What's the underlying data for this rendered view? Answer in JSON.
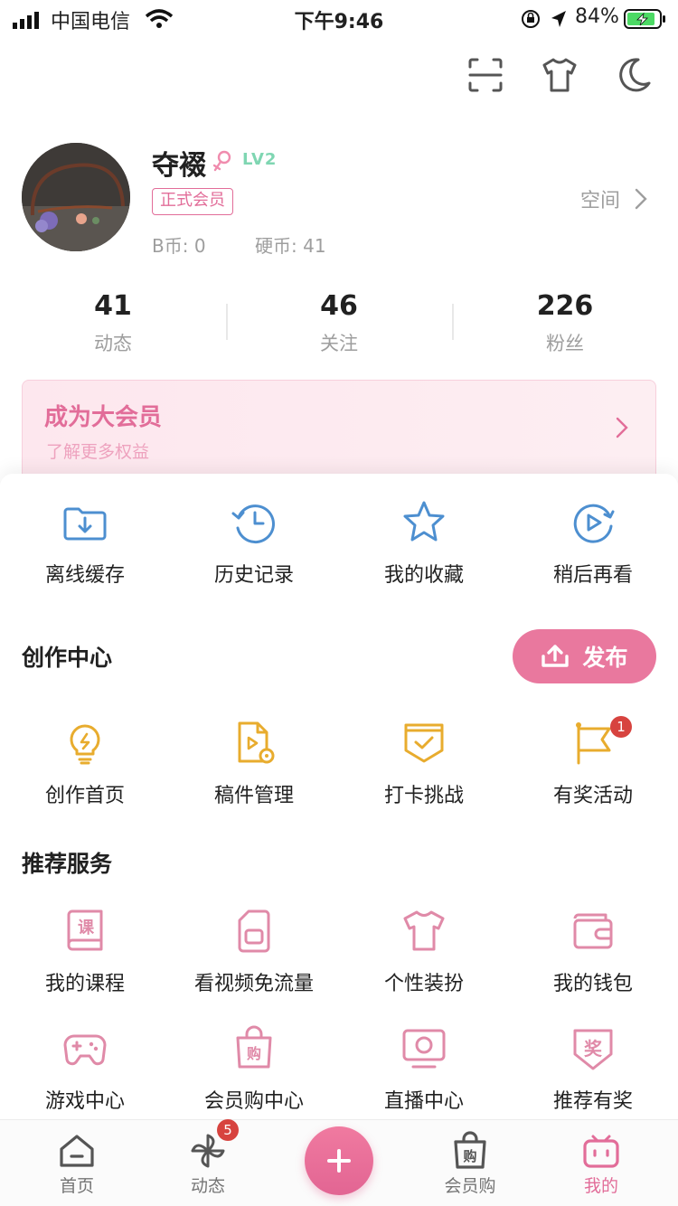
{
  "status_bar": {
    "carrier": "中国电信",
    "time": "下午9:46",
    "battery": "84%"
  },
  "header_icons": [
    "scan-icon",
    "tshirt-icon",
    "moon-icon"
  ],
  "profile": {
    "username": "夺裰",
    "level": "LV2",
    "vip_tag": "正式会员",
    "b_coin": "B币: 0",
    "hard_coin": "硬币: 41",
    "space_label": "空间"
  },
  "stats": [
    {
      "value": "41",
      "label": "动态"
    },
    {
      "value": "46",
      "label": "关注"
    },
    {
      "value": "226",
      "label": "粉丝"
    }
  ],
  "vip_banner": {
    "title": "成为大会员",
    "subtitle": "了解更多权益"
  },
  "quick_actions": [
    {
      "label": "离线缓存",
      "icon": "download-folder-icon"
    },
    {
      "label": "历史记录",
      "icon": "history-clock-icon"
    },
    {
      "label": "我的收藏",
      "icon": "star-icon"
    },
    {
      "label": "稍后再看",
      "icon": "watch-later-icon"
    }
  ],
  "creation_center": {
    "title": "创作中心",
    "publish_label": "发布",
    "items": [
      {
        "label": "创作首页",
        "icon": "lightbulb-icon"
      },
      {
        "label": "稿件管理",
        "icon": "document-play-icon"
      },
      {
        "label": "打卡挑战",
        "icon": "check-shield-icon"
      },
      {
        "label": "有奖活动",
        "icon": "flag-icon",
        "badge": "1"
      }
    ]
  },
  "recommended": {
    "title": "推荐服务",
    "items": [
      {
        "label": "我的课程",
        "icon": "course-book-icon",
        "glyph": "课"
      },
      {
        "label": "看视频免流量",
        "icon": "sim-card-icon"
      },
      {
        "label": "个性装扮",
        "icon": "tshirt-icon"
      },
      {
        "label": "我的钱包",
        "icon": "wallet-icon"
      },
      {
        "label": "游戏中心",
        "icon": "gamepad-icon"
      },
      {
        "label": "会员购中心",
        "icon": "shopping-bag-icon",
        "glyph": "购"
      },
      {
        "label": "直播中心",
        "icon": "tv-icon"
      },
      {
        "label": "推荐有奖",
        "icon": "award-badge-icon",
        "glyph": "奖"
      }
    ]
  },
  "tabbar": {
    "items": [
      {
        "label": "首页",
        "icon": "home-icon"
      },
      {
        "label": "动态",
        "icon": "pinwheel-icon",
        "badge": "5"
      },
      {
        "label": "会员购",
        "icon": "shopping-bag-icon",
        "glyph": "购"
      },
      {
        "label": "我的",
        "icon": "tv-face-icon",
        "active": true
      }
    ],
    "center_button": "plus-icon"
  },
  "colors": {
    "accent": "#e26d99",
    "accent_light": "#fde7ee",
    "blue_icon": "#4d8fd0",
    "yellow_icon": "#e8ac2e",
    "pink_icon": "#e08aa8"
  }
}
